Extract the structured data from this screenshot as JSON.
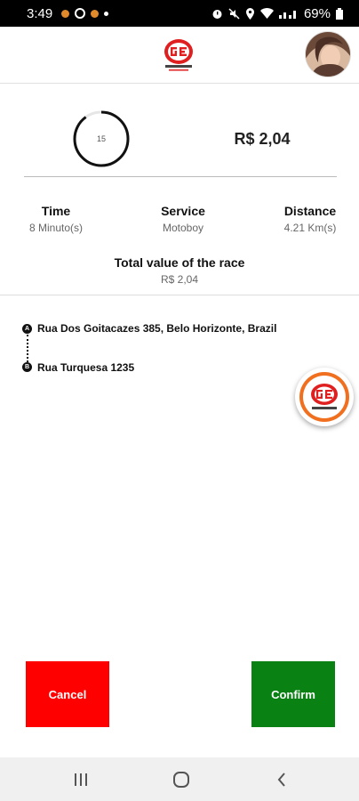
{
  "status_bar": {
    "time": "3:49",
    "battery": "69%"
  },
  "summary": {
    "timer_value": "15",
    "timer_progress": 0.9,
    "price": "R$ 2,04"
  },
  "stats": {
    "time_label": "Time",
    "time_value": "8 Minuto(s)",
    "service_label": "Service",
    "service_value": "Motoboy",
    "distance_label": "Distance",
    "distance_value": "4.21 Km(s)"
  },
  "total": {
    "label": "Total value of the race",
    "value": "R$ 2,04"
  },
  "route": {
    "marker_a": "A",
    "marker_b": "B",
    "origin": "Rua Dos Goitacazes 385, Belo Horizonte, Brazil",
    "destination": "Rua Turquesa 1235"
  },
  "actions": {
    "cancel_label": "Cancel",
    "confirm_label": "Confirm"
  },
  "colors": {
    "cancel": "#ff0000",
    "confirm": "#0a8113",
    "brand_red": "#e02020"
  },
  "icons": {
    "logo": "brand-logo-icon",
    "avatar": "user-avatar",
    "nav_recents": "recents-icon",
    "nav_home": "home-icon",
    "nav_back": "back-icon"
  }
}
